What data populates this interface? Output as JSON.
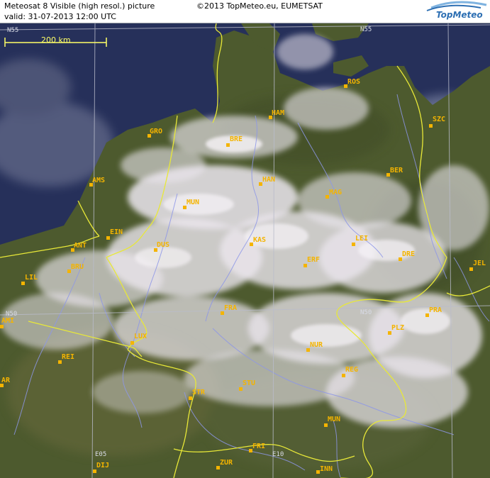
{
  "header": {
    "title": "Meteosat 8 Visible (high resol.) picture",
    "valid": "valid:  31-07-2013  12:00 UTC",
    "copyright": "©2013 TopMeteo.eu, EUMETSAT",
    "logo_text": "TopMeteo"
  },
  "scale_bar": {
    "label": "200 km"
  },
  "grid_labels": {
    "n55_left": "N55",
    "n55_right": "N55",
    "n50_left": "N50",
    "n50_right": "N50",
    "e05": "E05",
    "e10": "E10"
  },
  "cities": [
    {
      "code": "ROS"
    },
    {
      "code": "HAM"
    },
    {
      "code": "SZC"
    },
    {
      "code": "GRO"
    },
    {
      "code": "BRE"
    },
    {
      "code": "AMS"
    },
    {
      "code": "BER"
    },
    {
      "code": "HAN"
    },
    {
      "code": "MAG"
    },
    {
      "code": "MUN"
    },
    {
      "code": "EIN"
    },
    {
      "code": "ANT"
    },
    {
      "code": "DUS"
    },
    {
      "code": "KAS"
    },
    {
      "code": "LEI"
    },
    {
      "code": "DRE"
    },
    {
      "code": "LIL"
    },
    {
      "code": "BRU"
    },
    {
      "code": "ERF"
    },
    {
      "code": "JEL"
    },
    {
      "code": "FRA"
    },
    {
      "code": "PRA"
    },
    {
      "code": "AMI"
    },
    {
      "code": "PLZ"
    },
    {
      "code": "LUX"
    },
    {
      "code": "NUR"
    },
    {
      "code": "REI"
    },
    {
      "code": "REG"
    },
    {
      "code": "AR"
    },
    {
      "code": "STU"
    },
    {
      "code": "STR"
    },
    {
      "code": "MUN"
    },
    {
      "code": "FRI"
    },
    {
      "code": "ZUR"
    },
    {
      "code": "DIJ"
    },
    {
      "code": "INN"
    }
  ],
  "colors": {
    "sea": "#2b3560",
    "land": "#4e5a2f",
    "cloud": "#ece8ee",
    "border": "#e8e838",
    "river": "#8d96e8",
    "city": "#f4b400"
  }
}
